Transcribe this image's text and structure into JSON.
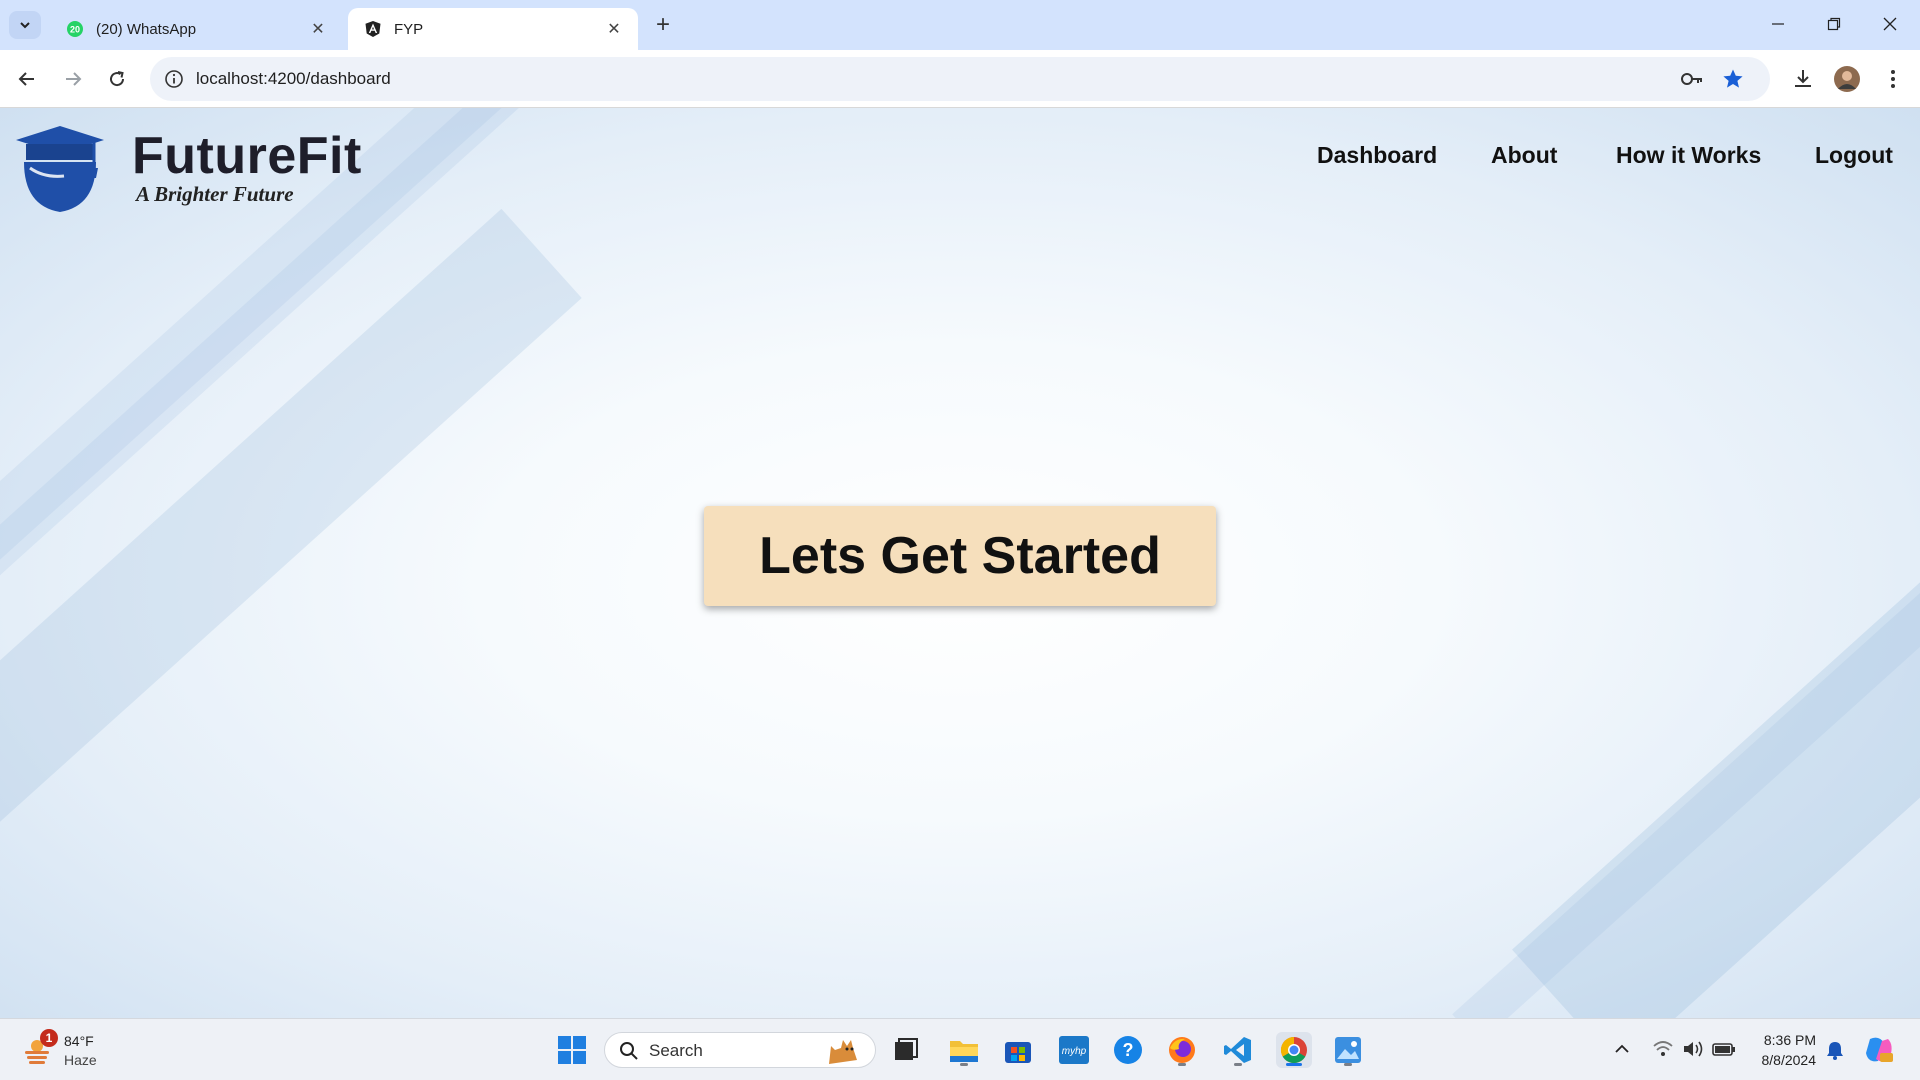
{
  "browser": {
    "tabs": [
      {
        "title": "(20) WhatsApp",
        "badge": "20"
      },
      {
        "title": "FYP"
      }
    ],
    "url": "localhost:4200/dashboard"
  },
  "site": {
    "brand": "FutureFit",
    "tagline": "A Brighter Future",
    "nav": [
      "Dashboard",
      "About",
      "How it Works",
      "Logout"
    ],
    "cta_label": "Lets Get Started",
    "colors": {
      "brand_blue": "#1f4fa8",
      "cta_bg": "#f6dfbc"
    }
  },
  "taskbar": {
    "weather_temp": "84°F",
    "weather_desc": "Haze",
    "weather_badge": "1",
    "search_placeholder": "Search",
    "time": "8:36 PM",
    "date": "8/8/2024"
  }
}
